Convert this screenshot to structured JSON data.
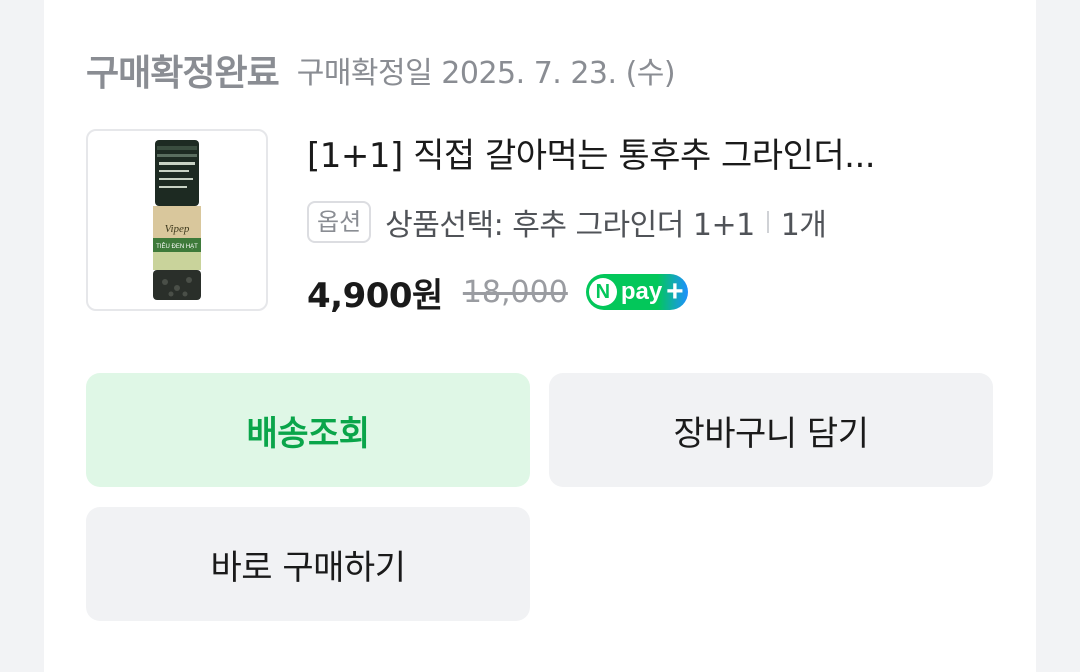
{
  "order": {
    "status_title": "구매확정완료",
    "status_date": "구매확정일 2025. 7. 23. (수)"
  },
  "product": {
    "name": "[1+1] 직접 갈아먹는 통후추 그라인더...",
    "option_badge": "옵션",
    "option_text": "상품선택: 후추 그라인더 1+1",
    "quantity": "1개",
    "sale_price": "4,900원",
    "original_price": "18,000",
    "image_label": "Vipep",
    "image_subtext": "TIÊU ĐEN HẠT",
    "npay": {
      "n": "N",
      "text": "pay",
      "plus": "+"
    }
  },
  "actions": {
    "track_label": "배송조회",
    "cart_label": "장바구니 담기",
    "buy_label": "바로 구매하기"
  },
  "colors": {
    "accent_green": "#0aa54a",
    "track_bg": "#dff7e6",
    "neutral_bg": "#f1f2f4",
    "npay_green": "#03c75a",
    "npay_blue": "#1e90ff"
  }
}
